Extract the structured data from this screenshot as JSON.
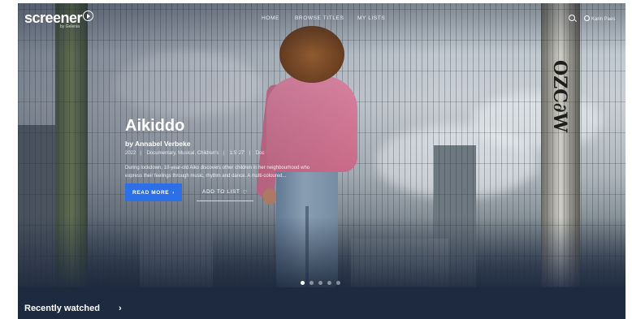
{
  "brand": {
    "name": "screener",
    "sub": "by Gelenia"
  },
  "nav": {
    "items": [
      {
        "label": "HOME"
      },
      {
        "label": "BROWSE TITLES"
      },
      {
        "label": "MY LISTS"
      }
    ],
    "user_name": "Karin Paes"
  },
  "hero": {
    "title": "Aikiddo",
    "byline": "by Annabel Verbeke",
    "meta": [
      "2022",
      "Documentary, Musical, Children's",
      "1:5' 27'",
      "Doc"
    ],
    "description": "During lockdown, 10-year-old Aiko discovers other children in her neighbourhood who express their feelings through music, rhythm and dance. A multi-coloured...",
    "read_more_label": "READ MORE",
    "add_to_list_label": "ADD TO LIST",
    "slide_count": 5,
    "active_slide": 1
  },
  "section": {
    "title": "Recently watched",
    "arrow": "›"
  },
  "colors": {
    "accent": "#2c6fe6",
    "page_bg": "#1e2a3f"
  }
}
